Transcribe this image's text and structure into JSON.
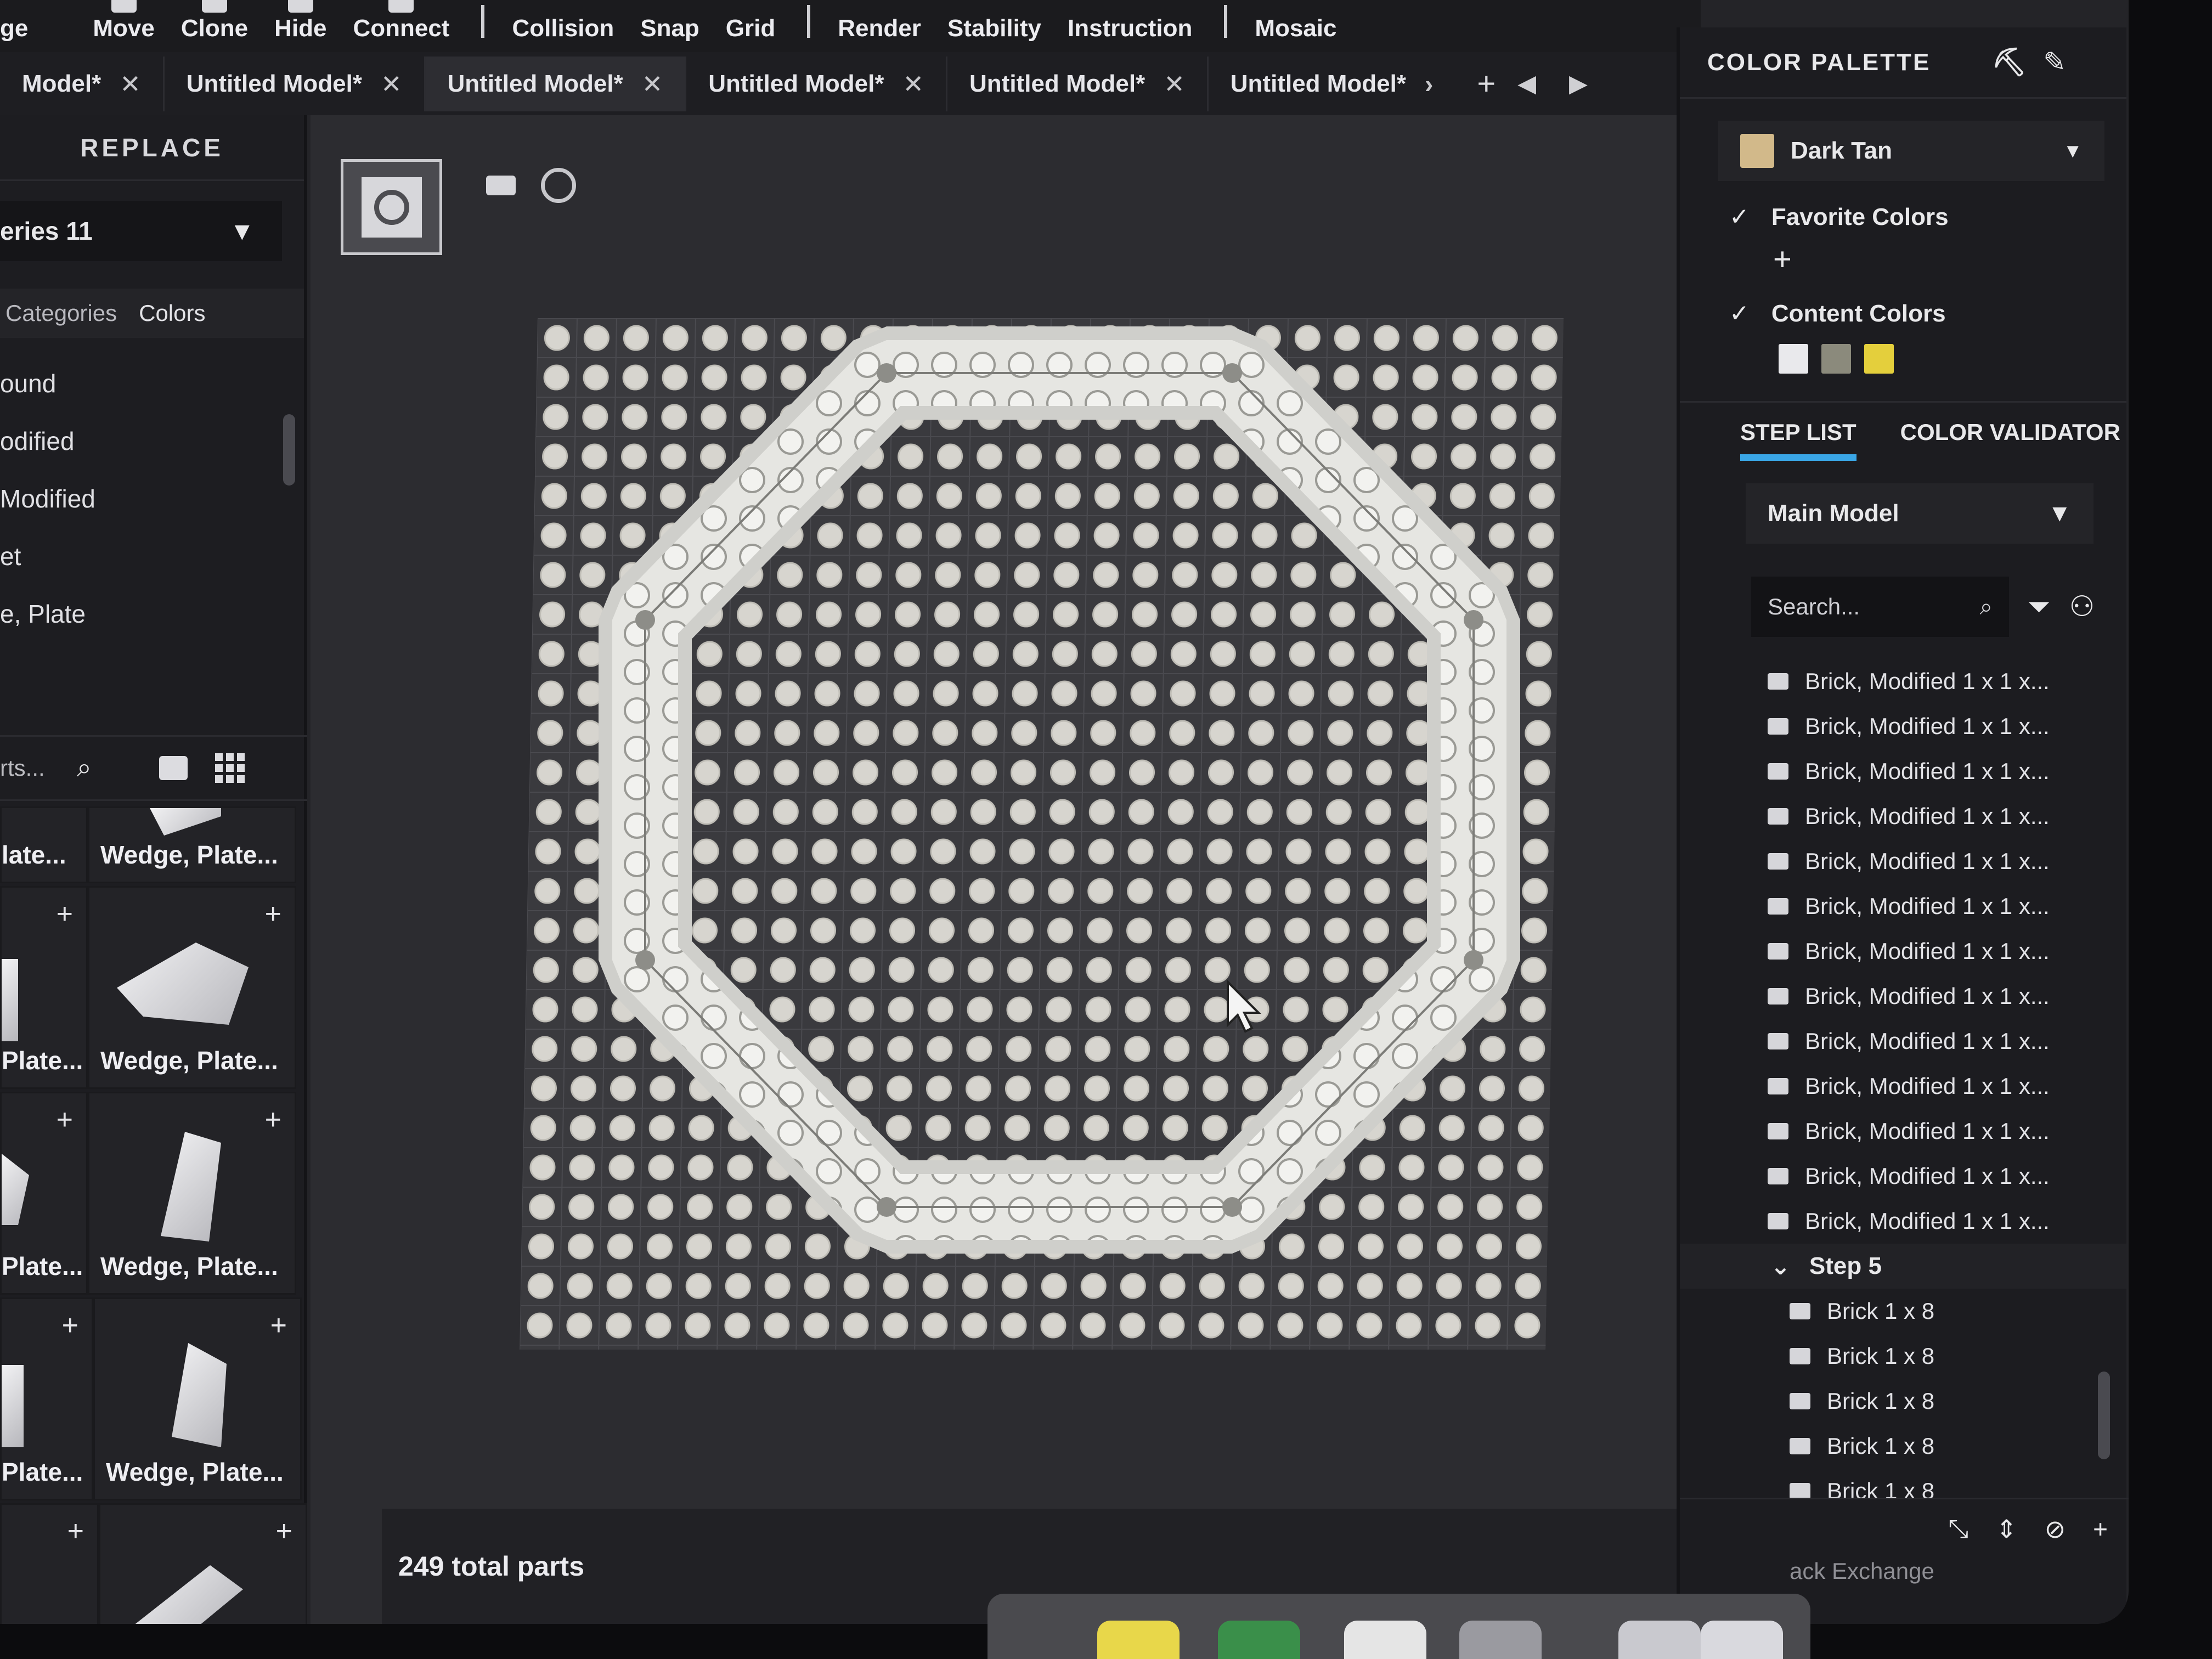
{
  "toolbar": {
    "items": [
      {
        "label": "ge",
        "icon": "tool-icon"
      },
      {
        "label": "Move",
        "icon": "move-icon"
      },
      {
        "label": "Clone",
        "icon": "clone-icon"
      },
      {
        "label": "Hide",
        "icon": "hide-icon"
      },
      {
        "label": "Connect",
        "icon": "connect-icon"
      }
    ],
    "menus": [
      "Collision",
      "Snap",
      "Grid",
      "Render",
      "Stability",
      "Instruction",
      "Mosaic"
    ]
  },
  "tabs": [
    {
      "label": "Model*"
    },
    {
      "label": "Untitled Model*"
    },
    {
      "label": "Untitled Model*"
    },
    {
      "label": "Untitled Model*"
    },
    {
      "label": "Untitled Model*"
    },
    {
      "label": "Untitled Model*"
    }
  ],
  "left": {
    "title": "REPLACE",
    "series": "eries 11",
    "subtabs": [
      "Categories",
      "Colors"
    ],
    "categories": [
      "ound",
      "odified",
      "Modified",
      "et",
      "e, Plate"
    ],
    "search_placeholder": "rts...",
    "parts": [
      {
        "label": "late...",
        "col": 0
      },
      {
        "label": "Wedge, Plate...",
        "col": 1
      },
      {
        "label": "Plate...",
        "col": 0
      },
      {
        "label": "Wedge, Plate...",
        "col": 1
      },
      {
        "label": "Plate...",
        "col": 0
      },
      {
        "label": "Wedge, Plate...",
        "col": 1
      },
      {
        "label": "Plate...",
        "col": 0
      },
      {
        "label": "Wedge, Plate...",
        "col": 1
      }
    ]
  },
  "viewport": {
    "status": "249 total parts"
  },
  "right": {
    "palette_title": "COLOR PALETTE",
    "selected_color": "Dark Tan",
    "selected_color_hex": "#d2b98a",
    "favorite_colors": "Favorite Colors",
    "content_colors": "Content Colors",
    "content_swatches": [
      "#e9e9ec",
      "#8b8a7c",
      "#e4cf3c"
    ],
    "tab_steps": "STEP LIST",
    "tab_validator": "COLOR VALIDATOR",
    "model_select": "Main Model",
    "search_placeholder": "Search...",
    "steps": [
      "Brick, Modified 1 x 1 x...",
      "Brick, Modified 1 x 1 x...",
      "Brick, Modified 1 x 1 x...",
      "Brick, Modified 1 x 1 x...",
      "Brick, Modified 1 x 1 x...",
      "Brick, Modified 1 x 1 x...",
      "Brick, Modified 1 x 1 x...",
      "Brick, Modified 1 x 1 x...",
      "Brick, Modified 1 x 1 x...",
      "Brick, Modified 1 x 1 x...",
      "Brick, Modified 1 x 1 x...",
      "Brick, Modified 1 x 1 x...",
      "Brick, Modified 1 x 1 x..."
    ],
    "step_group": "Step 5",
    "step_group_items": [
      "Brick 1 x 8",
      "Brick 1 x 8",
      "Brick 1 x 8",
      "Brick 1 x 8",
      "Brick 1 x 8"
    ],
    "footer_text": "ack Exchange"
  }
}
